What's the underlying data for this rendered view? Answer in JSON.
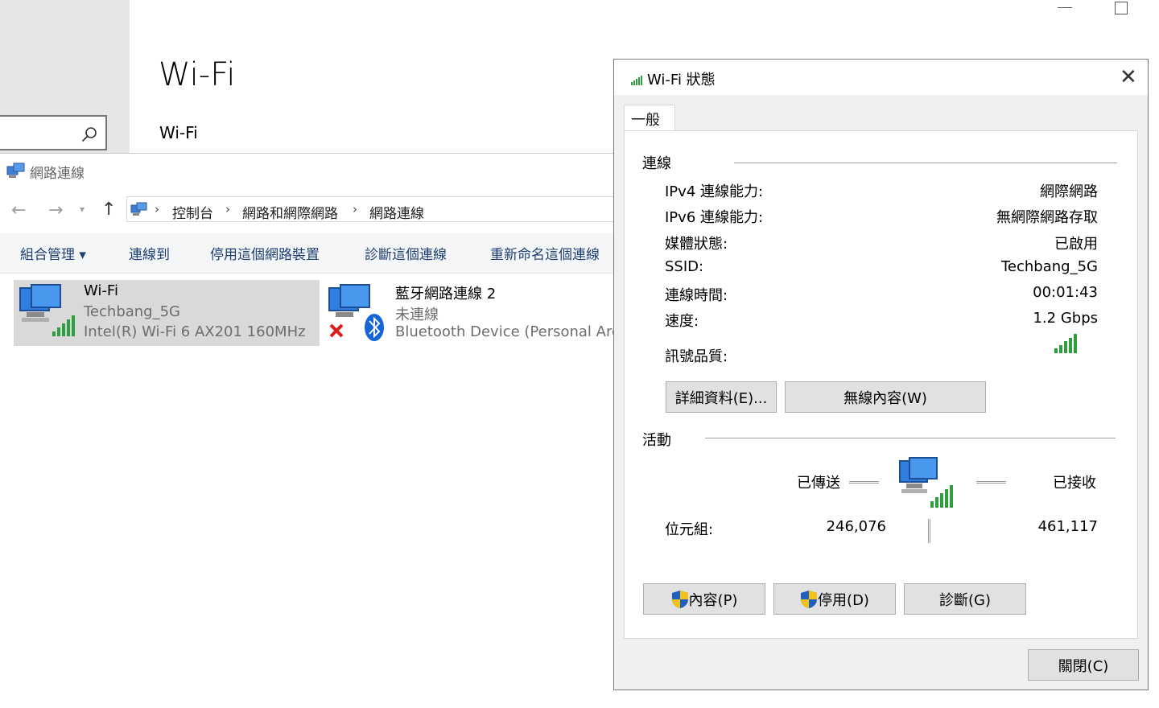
{
  "settings": {
    "title": "Wi-Fi",
    "subtitle": "Wi-Fi"
  },
  "network_connections": {
    "window_title": "網路連線",
    "breadcrumb": [
      "控制台",
      "網路和網際網路",
      "網路連線"
    ],
    "toolbar": [
      "組合管理 ▾",
      "連線到",
      "停用這個網路裝置",
      "診斷這個連線",
      "重新命名這個連線"
    ],
    "items": [
      {
        "name": "Wi-Fi",
        "status": "Techbang_5G",
        "device": "Intel(R) Wi-Fi 6 AX201 160MHz"
      },
      {
        "name": "藍牙網路連線 2",
        "status": "未連線",
        "device": "Bluetooth Device (Personal Are."
      }
    ]
  },
  "status_dialog": {
    "title": "Wi-Fi 狀態",
    "tab": "一般",
    "connection_group": "連線",
    "fields": [
      {
        "label": "IPv4 連線能力:",
        "value": "網際網路"
      },
      {
        "label": "IPv6 連線能力:",
        "value": "無網際網路存取"
      },
      {
        "label": "媒體狀態:",
        "value": "已啟用"
      },
      {
        "label": "SSID:",
        "value": "Techbang_5G"
      },
      {
        "label": "連線時間:",
        "value": "00:01:43"
      },
      {
        "label": "速度:",
        "value": "1.2 Gbps"
      }
    ],
    "signal_label": "訊號品質:",
    "signal_bars": 5,
    "details_button": "詳細資料(E)...",
    "wireless_button": "無線內容(W)",
    "activity_group": "活動",
    "sent_label": "已傳送",
    "received_label": "已接收",
    "bytes_label": "位元組:",
    "bytes_sent": "246,076",
    "bytes_received": "461,117",
    "properties_button": "內容(P)",
    "disable_button": "停用(D)",
    "diagnose_button": "診斷(G)",
    "close_button": "關閉(C)"
  },
  "colors": {
    "toolbar_text": "#1e3f73",
    "signal_green": "#2e9e3e",
    "shield_blue": "#1f5fbf",
    "shield_yellow": "#f2c21a"
  }
}
